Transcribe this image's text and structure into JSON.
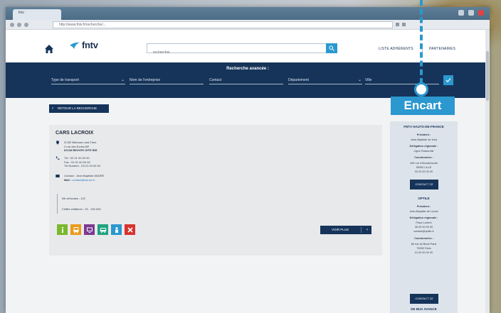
{
  "browser": {
    "tab_title": "fntv",
    "url": "http://www.fntv.fr/recherche/..."
  },
  "header": {
    "logo_text": "fntv",
    "search_placeholder": "rechercher",
    "link_1": "LISTE ADHÉRENTS",
    "link_2": "PARTENAIRES"
  },
  "search_band": {
    "title": "Recherche avancée :",
    "filters": [
      "Type de transport",
      "Nom de l'entreprise",
      "Contact",
      "Département",
      "Ville"
    ]
  },
  "back_button": "RETOUR LA RECHERCHE",
  "card": {
    "title": "CARS LACROIX",
    "address_lines": [
      "ZI DE Béthune nord-Tiers",
      "2 rue des Ecrins BP",
      "62138 BEUVRY-SITE BIS"
    ],
    "phone_lines": [
      "Tél : 03 21 00 00 00",
      "Fax : 03 21 00 00 00",
      "Tél Numéro : 03 21 00 00 00"
    ],
    "contact_line": "Contact : Jean Baptiste ANDRE",
    "email_label": "Mail :",
    "email": "contact@lacroix.fr",
    "stat_1": "Nb véhicules : 122",
    "stat_2": "Chiffre d'affaires : 23 - 150 000",
    "see_more": "VOIR PLUS"
  },
  "services": [
    {
      "icon": "info-icon",
      "color": "#7ab82e"
    },
    {
      "icon": "bus-icon",
      "color": "#e99b1c"
    },
    {
      "icon": "screen-icon",
      "color": "#7b3a90"
    },
    {
      "icon": "coach-icon",
      "color": "#1fa37e"
    },
    {
      "icon": "person-icon",
      "color": "#2b98cf"
    },
    {
      "icon": "tools-icon",
      "color": "#d8322f"
    }
  ],
  "insert": {
    "head_1": "FNTV HAUTS-DE-FRANCE",
    "label_president": "Président :",
    "president_name": "Jean-Baptiste de fond",
    "label_delegate": "Délégation régionale :",
    "delegate_name": "Ligne Passerelle",
    "label_contact": "Coordonnées :",
    "contact_lines": [
      "160 rue d'Hondschoote",
      "59000 LILLE",
      "03 20 00 00 00"
    ],
    "button": "CONTACT ZZ",
    "head_2": "OPTILE",
    "label_president_2": "Président :",
    "president_2": "Jean-Baptiste de Lorest",
    "label_delegate_2": "Délégation régionale :",
    "delegate_2_lines": [
      "Place Lorient",
      "06 00 00 00 00",
      "contact@optile.fr"
    ],
    "label_contact_2": "Coordonnées :",
    "contact_2_lines": [
      "86 rue de Brest Paris",
      "75000 Paris",
      "01 00 00 00 00"
    ],
    "button_2": "CONTACT ZZ",
    "footer": "DE BUS AVANCE"
  },
  "callout": {
    "label": "Encart",
    "color": "#2b98cf"
  },
  "colors": {
    "navy": "#16345a",
    "accent": "#2b98cf"
  }
}
